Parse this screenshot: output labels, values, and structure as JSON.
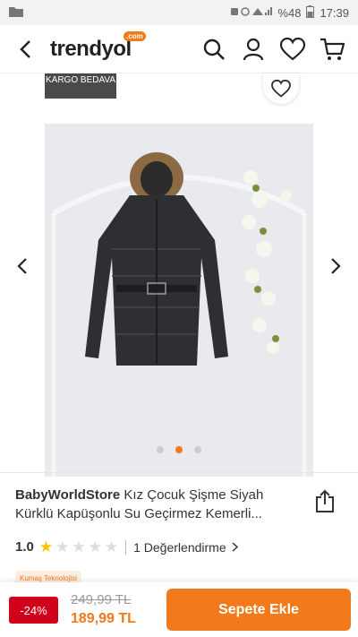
{
  "status_bar": {
    "battery": "%48",
    "time": "17:39"
  },
  "header": {
    "logo_text": "trendyol",
    "logo_badge": ".com"
  },
  "gallery": {
    "badge": "KARGO BEDAVA",
    "current_index": 2,
    "total_images": 3
  },
  "product": {
    "brand": "BabyWorldStore",
    "title": "Kız Çocuk Şişme Siyah Kürklü Kapüşonlu Su Geçirmez Kemerli...",
    "rating": "1.0",
    "rating_value": 1,
    "reviews": "1 Değerlendirme",
    "tag": "Kumaş Teknolojisi"
  },
  "pricing": {
    "discount": "-24%",
    "old_price": "249,99 TL",
    "new_price": "189,99 TL",
    "add_to_cart_label": "Sepete Ekle"
  },
  "colors": {
    "accent": "#f27a1a",
    "discount": "#d0021b",
    "star": "#ffc000"
  }
}
